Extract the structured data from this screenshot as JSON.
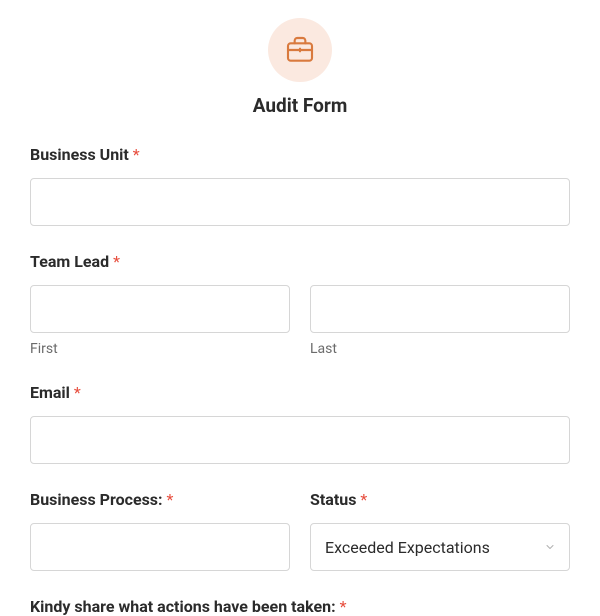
{
  "header": {
    "title": "Audit Form"
  },
  "fields": {
    "business_unit": {
      "label": "Business Unit",
      "required": "*",
      "value": ""
    },
    "team_lead": {
      "label": "Team Lead",
      "required": "*",
      "first_value": "",
      "first_sublabel": "First",
      "last_value": "",
      "last_sublabel": "Last"
    },
    "email": {
      "label": "Email",
      "required": "*",
      "value": ""
    },
    "business_process": {
      "label": "Business Process:",
      "required": "*",
      "value": ""
    },
    "status": {
      "label": "Status",
      "required": "*",
      "selected": "Exceeded Expectations"
    },
    "actions": {
      "label": "Kindy share what actions have been taken:",
      "required": "*"
    }
  }
}
